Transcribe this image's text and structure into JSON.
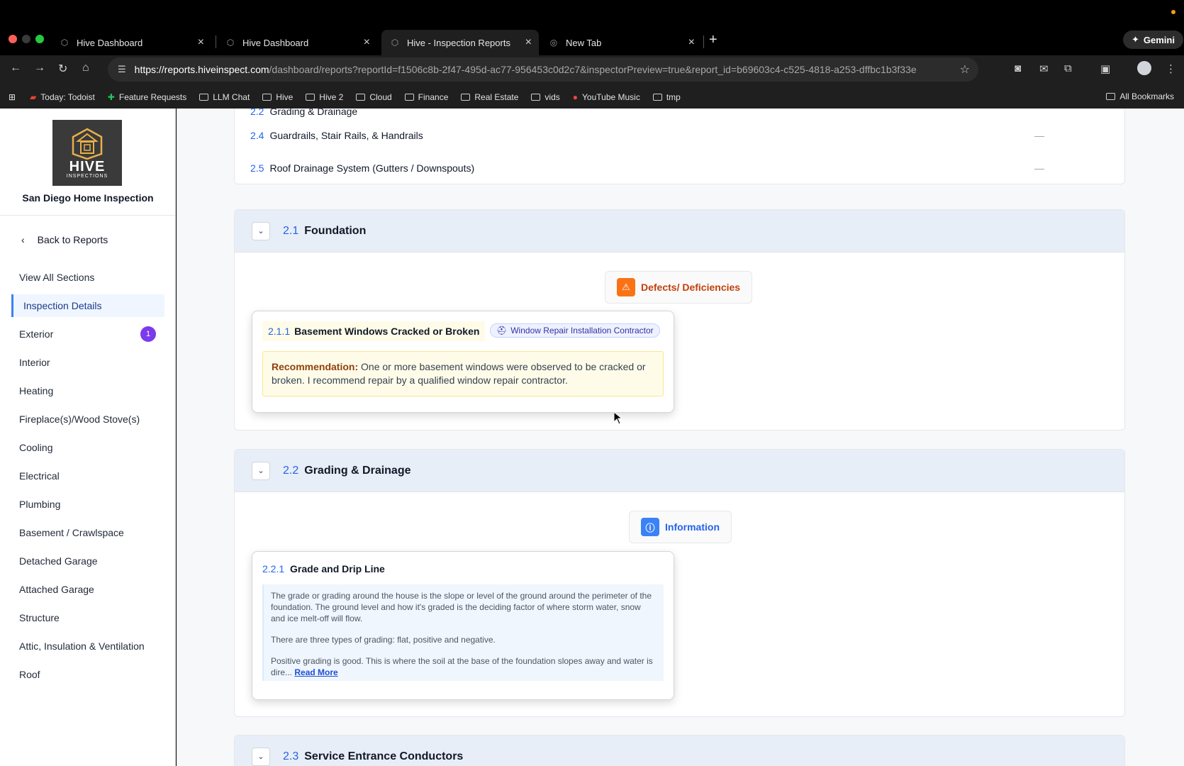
{
  "browser": {
    "tabs": [
      {
        "title": "Hive Dashboard"
      },
      {
        "title": "Hive Dashboard"
      },
      {
        "title": "Hive - Inspection Reports"
      },
      {
        "title": "New Tab"
      }
    ],
    "gemini_label": "Gemini",
    "url_host": "https://reports.hiveinspect.com",
    "url_path": "/dashboard/reports?reportId=f1506c8b-2f47-495d-ac77-956453c0d2c7&inspectorPreview=true&report_id=b69603c4-c525-4818-a253-dffbc1b3f33e",
    "bookmarks": [
      "Today: Todoist",
      "Feature Requests",
      "LLM Chat",
      "Hive",
      "Hive 2",
      "Cloud",
      "Finance",
      "Real Estate",
      "vids",
      "YouTube Music",
      "tmp"
    ],
    "all_bookmarks": "All Bookmarks"
  },
  "sidebar": {
    "logo_text": "HIVE",
    "logo_sub": "INSPECTIONS",
    "company": "San Diego Home Inspection",
    "back": "Back to Reports",
    "items": [
      {
        "label": "View All Sections"
      },
      {
        "label": "Inspection Details"
      },
      {
        "label": "Exterior",
        "badge": "1"
      },
      {
        "label": "Interior"
      },
      {
        "label": "Heating"
      },
      {
        "label": "Fireplace(s)/Wood Stove(s)"
      },
      {
        "label": "Cooling"
      },
      {
        "label": "Electrical"
      },
      {
        "label": "Plumbing"
      },
      {
        "label": "Basement / Crawlspace"
      },
      {
        "label": "Detached Garage"
      },
      {
        "label": "Attached Garage"
      },
      {
        "label": "Structure"
      },
      {
        "label": "Attic, Insulation & Ventilation"
      },
      {
        "label": "Roof"
      }
    ]
  },
  "main": {
    "list": [
      {
        "num": "2.2",
        "label": "Grading & Drainage"
      },
      {
        "num": "2.4",
        "label": "Guardrails, Stair Rails, & Handrails",
        "value": "—"
      },
      {
        "num": "2.5",
        "label": "Roof Drainage System (Gutters / Downspouts)",
        "value": "—"
      }
    ],
    "foundation": {
      "num": "2.1",
      "title": "Foundation",
      "pill": "Defects/ Deficiencies",
      "item_num": "2.1.1",
      "item_title": "Basement Windows Cracked or Broken",
      "contractor": "Window Repair Installation Contractor",
      "reco_label": "Recommendation:",
      "reco_text": " One or more basement windows were observed to be cracked or broken. I recommend repair by a qualified window repair contractor."
    },
    "grading": {
      "num": "2.2",
      "title": "Grading & Drainage",
      "pill": "Information",
      "item_num": "2.2.1",
      "item_title": "Grade and Drip Line",
      "p1": "The grade or grading around the house is the slope or level of the ground around the perimeter of the foundation. The ground level and how it's graded is the deciding factor of where storm water, snow and ice melt-off will flow.",
      "p2": "There are three types of grading: flat, positive and negative.",
      "p3": "Positive grading is good. This is where the soil at the base of the foundation slopes away and water is dire...",
      "read_more": "Read More"
    },
    "service": {
      "num": "2.3",
      "title": "Service Entrance Conductors"
    }
  }
}
